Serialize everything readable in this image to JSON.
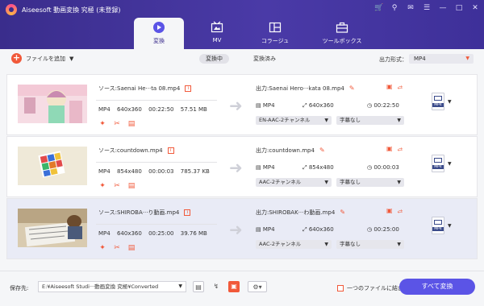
{
  "app": {
    "title": "Aiseesoft 動画変換 究極 (未登録)"
  },
  "window_icons": [
    "cart-icon",
    "key-icon",
    "chat-icon",
    "menu-icon",
    "minimize-icon",
    "maximize-icon",
    "close-icon"
  ],
  "tabs": [
    {
      "label": "変換",
      "icon": "convert-icon",
      "active": true
    },
    {
      "label": "MV",
      "icon": "mv-icon",
      "active": false
    },
    {
      "label": "コラージュ",
      "icon": "collage-icon",
      "active": false
    },
    {
      "label": "ツールボックス",
      "icon": "toolbox-icon",
      "active": false
    }
  ],
  "toolbar": {
    "add_files": "ファイルを追加",
    "tab_converting": "変換中",
    "tab_converted": "変換済み",
    "output_format_label": "出力形式：",
    "output_format_value": "MP4"
  },
  "rows": [
    {
      "source": "ソース:Saenai He···ta 08.mp4",
      "format": "MP4",
      "resolution": "640x360",
      "duration": "00:22:50",
      "size": "57.51 MB",
      "output": "出力:Saenai Hero···kata 08.mp4",
      "out_format": "MP4",
      "out_resolution": "640x360",
      "out_duration": "00:22:50",
      "audio": "EN-AAC-2チャンネル",
      "subtitle": "字幕なし",
      "badge": "MP4",
      "selected": false
    },
    {
      "source": "ソース:countdown.mp4",
      "format": "MP4",
      "resolution": "854x480",
      "duration": "00:00:03",
      "size": "785.37 KB",
      "output": "出力:countdown.mp4",
      "out_format": "MP4",
      "out_resolution": "854x480",
      "out_duration": "00:00:03",
      "audio": "AAC-2チャンネル",
      "subtitle": "字幕なし",
      "badge": "MP4",
      "selected": false
    },
    {
      "source": "ソース:SHIROBA···り動画.mp4",
      "format": "MP4",
      "resolution": "640x360",
      "duration": "00:25:00",
      "size": "39.76 MB",
      "output": "出力:SHIROBAK···わ動画.mp4",
      "out_format": "MP4",
      "out_resolution": "640x360",
      "out_duration": "00:25:00",
      "audio": "AAC-2チャンネル",
      "subtitle": "字幕なし",
      "badge": "MP4",
      "selected": true
    }
  ],
  "bottom": {
    "save_label": "保存先:",
    "save_path": "E:¥Aiseesoft Studi···動画変換 究極¥Converted",
    "merge_label": "一つのファイルに結合",
    "convert_all": "すべて変換"
  }
}
